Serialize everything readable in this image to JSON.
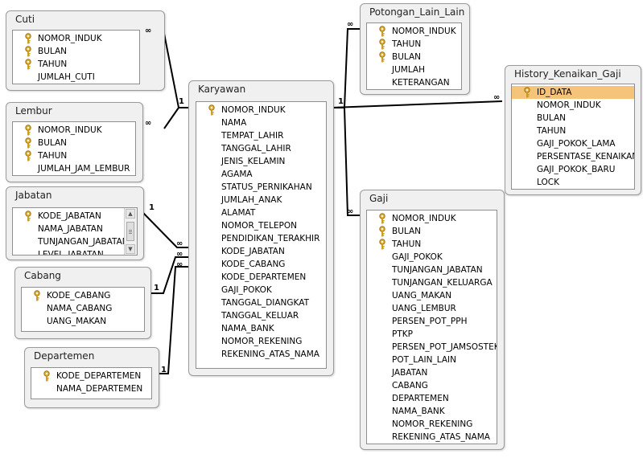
{
  "tables": {
    "cuti": {
      "title": "Cuti",
      "fields": [
        {
          "name": "NOMOR_INDUK",
          "key": true
        },
        {
          "name": "BULAN",
          "key": true
        },
        {
          "name": "TAHUN",
          "key": true
        },
        {
          "name": "JUMLAH_CUTI",
          "key": false
        }
      ]
    },
    "lembur": {
      "title": "Lembur",
      "fields": [
        {
          "name": "NOMOR_INDUK",
          "key": true
        },
        {
          "name": "BULAN",
          "key": true
        },
        {
          "name": "TAHUN",
          "key": true
        },
        {
          "name": "JUMLAH_JAM_LEMBUR",
          "key": false
        }
      ]
    },
    "jabatan": {
      "title": "Jabatan",
      "fields": [
        {
          "name": "KODE_JABATAN",
          "key": true
        },
        {
          "name": "NAMA_JABATAN",
          "key": false
        },
        {
          "name": "TUNJANGAN_JABATAN",
          "key": false
        },
        {
          "name": "LEVEL_JABATAN",
          "key": false
        }
      ]
    },
    "cabang": {
      "title": "Cabang",
      "fields": [
        {
          "name": "KODE_CABANG",
          "key": true
        },
        {
          "name": "NAMA_CABANG",
          "key": false
        },
        {
          "name": "UANG_MAKAN",
          "key": false
        }
      ]
    },
    "departemen": {
      "title": "Departemen",
      "fields": [
        {
          "name": "KODE_DEPARTEMEN",
          "key": true
        },
        {
          "name": "NAMA_DEPARTEMEN",
          "key": false
        }
      ]
    },
    "karyawan": {
      "title": "Karyawan",
      "fields": [
        {
          "name": "NOMOR_INDUK",
          "key": true
        },
        {
          "name": "NAMA",
          "key": false
        },
        {
          "name": "TEMPAT_LAHIR",
          "key": false
        },
        {
          "name": "TANGGAL_LAHIR",
          "key": false
        },
        {
          "name": "JENIS_KELAMIN",
          "key": false
        },
        {
          "name": "AGAMA",
          "key": false
        },
        {
          "name": "STATUS_PERNIKAHAN",
          "key": false
        },
        {
          "name": "JUMLAH_ANAK",
          "key": false
        },
        {
          "name": "ALAMAT",
          "key": false
        },
        {
          "name": "NOMOR_TELEPON",
          "key": false
        },
        {
          "name": "PENDIDIKAN_TERAKHIR",
          "key": false
        },
        {
          "name": "KODE_JABATAN",
          "key": false
        },
        {
          "name": "KODE_CABANG",
          "key": false
        },
        {
          "name": "KODE_DEPARTEMEN",
          "key": false
        },
        {
          "name": "GAJI_POKOK",
          "key": false
        },
        {
          "name": "TANGGAL_DIANGKAT",
          "key": false
        },
        {
          "name": "TANGGAL_KELUAR",
          "key": false
        },
        {
          "name": "NAMA_BANK",
          "key": false
        },
        {
          "name": "NOMOR_REKENING",
          "key": false
        },
        {
          "name": "REKENING_ATAS_NAMA",
          "key": false
        }
      ]
    },
    "potongan": {
      "title": "Potongan_Lain_Lain",
      "fields": [
        {
          "name": "NOMOR_INDUK",
          "key": true
        },
        {
          "name": "TAHUN",
          "key": true
        },
        {
          "name": "BULAN",
          "key": true
        },
        {
          "name": "JUMLAH",
          "key": false
        },
        {
          "name": "KETERANGAN",
          "key": false
        }
      ]
    },
    "history": {
      "title": "History_Kenaikan_Gaji",
      "fields": [
        {
          "name": "ID_DATA",
          "key": true,
          "selected": true
        },
        {
          "name": "NOMOR_INDUK",
          "key": false
        },
        {
          "name": "BULAN",
          "key": false
        },
        {
          "name": "TAHUN",
          "key": false
        },
        {
          "name": "GAJI_POKOK_LAMA",
          "key": false
        },
        {
          "name": "PERSENTASE_KENAIKAN",
          "key": false
        },
        {
          "name": "GAJI_POKOK_BARU",
          "key": false
        },
        {
          "name": "LOCK",
          "key": false
        }
      ]
    },
    "gaji": {
      "title": "Gaji",
      "fields": [
        {
          "name": "NOMOR_INDUK",
          "key": true
        },
        {
          "name": "BULAN",
          "key": true
        },
        {
          "name": "TAHUN",
          "key": true
        },
        {
          "name": "GAJI_POKOK",
          "key": false
        },
        {
          "name": "TUNJANGAN_JABATAN",
          "key": false
        },
        {
          "name": "TUNJANGAN_KELUARGA",
          "key": false
        },
        {
          "name": "UANG_MAKAN",
          "key": false
        },
        {
          "name": "UANG_LEMBUR",
          "key": false
        },
        {
          "name": "PERSEN_POT_PPH",
          "key": false
        },
        {
          "name": "PTKP",
          "key": false
        },
        {
          "name": "PERSEN_POT_JAMSOSTEK",
          "key": false
        },
        {
          "name": "POT_LAIN_LAIN",
          "key": false
        },
        {
          "name": "JABATAN",
          "key": false
        },
        {
          "name": "CABANG",
          "key": false
        },
        {
          "name": "DEPARTEMEN",
          "key": false
        },
        {
          "name": "NAMA_BANK",
          "key": false
        },
        {
          "name": "NOMOR_REKENING",
          "key": false
        },
        {
          "name": "REKENING_ATAS_NAMA",
          "key": false
        }
      ]
    }
  },
  "cardinality": {
    "one": "1",
    "many": "∞"
  },
  "colors": {
    "selected_row": "#f5c37a",
    "key_icon": "#d9a520"
  }
}
